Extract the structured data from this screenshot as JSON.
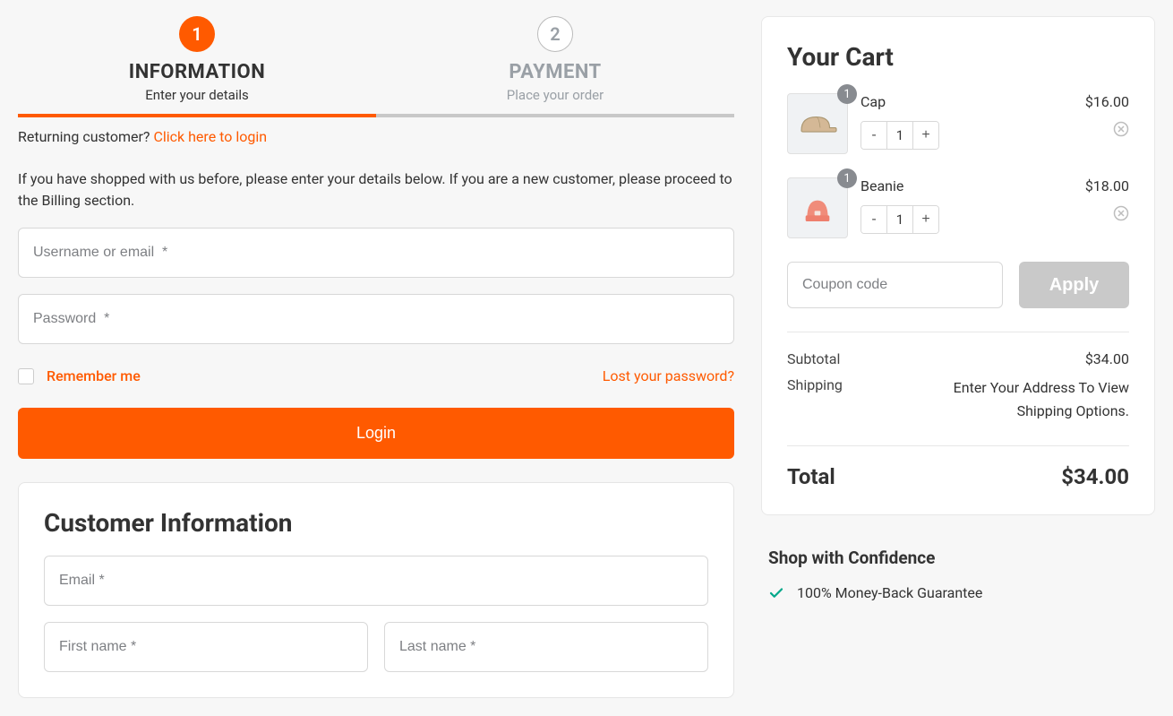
{
  "steps": [
    {
      "num": "1",
      "title": "INFORMATION",
      "subtitle": "Enter your details"
    },
    {
      "num": "2",
      "title": "PAYMENT",
      "subtitle": "Place your order"
    }
  ],
  "returning": {
    "prefix": "Returning customer? ",
    "link": "Click here to login"
  },
  "login": {
    "info": "If you have shopped with us before, please enter your details below. If you are a new customer, please proceed to the Billing section.",
    "username_placeholder": "Username or email  *",
    "password_placeholder": "Password  *",
    "remember_label": "Remember me",
    "lost_password": "Lost your password?",
    "button": "Login"
  },
  "customer": {
    "heading": "Customer Information",
    "email_placeholder": "Email *",
    "first_placeholder": "First name *",
    "last_placeholder": "Last name *"
  },
  "cart": {
    "heading": "Your Cart",
    "items": [
      {
        "name": "Cap",
        "qty": "1",
        "price": "$16.00",
        "badge": "1"
      },
      {
        "name": "Beanie",
        "qty": "1",
        "price": "$18.00",
        "badge": "1"
      }
    ],
    "coupon_placeholder": "Coupon code",
    "apply": "Apply",
    "subtotal_label": "Subtotal",
    "subtotal_value": "$34.00",
    "shipping_label": "Shipping",
    "shipping_value": "Enter Your Address To View Shipping Options.",
    "total_label": "Total",
    "total_value": "$34.00"
  },
  "confidence": {
    "heading": "Shop with Confidence",
    "items": [
      "100% Money-Back Guarantee"
    ]
  }
}
